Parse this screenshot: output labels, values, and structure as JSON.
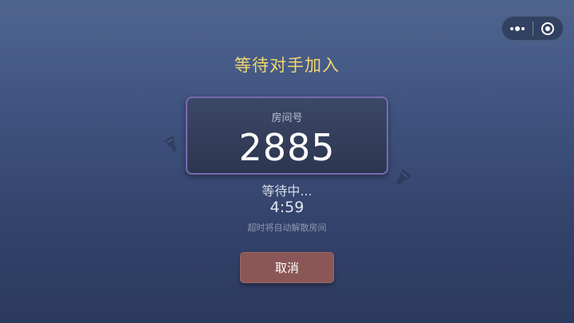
{
  "capsule": {
    "more_icon": "more-dots-icon",
    "close_icon": "target-circle-icon"
  },
  "title": "等待对手加入",
  "room": {
    "label": "房间号",
    "number": "2885"
  },
  "status": {
    "waiting": "等待中...",
    "timer": "4:59",
    "note": "超时将自动解散房间"
  },
  "cancel_label": "取消",
  "colors": {
    "title": "#f2d66e",
    "card_border": "#7a6ab0",
    "cancel_bg": "#8a5656"
  }
}
